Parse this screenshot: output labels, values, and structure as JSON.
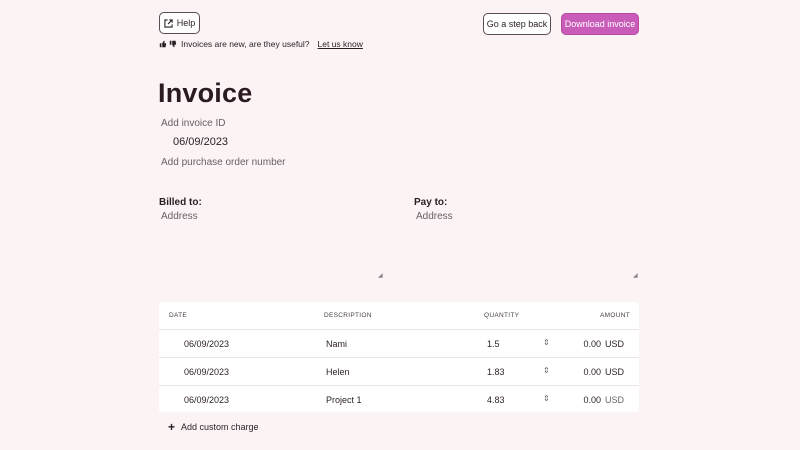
{
  "header": {
    "help_label": "Help",
    "back_label": "Go a step back",
    "download_label": "Download invoice"
  },
  "feedback": {
    "text": "Invoices are new, are they useful?",
    "link": "Let us know"
  },
  "invoice": {
    "title": "Invoice",
    "id_placeholder": "Add invoice ID",
    "date": "06/09/2023",
    "po_placeholder": "Add purchase order number"
  },
  "billed_to": {
    "label": "Billed to:",
    "address_placeholder": "Address"
  },
  "pay_to": {
    "label": "Pay to:",
    "address_placeholder": "Address"
  },
  "table": {
    "headers": {
      "date": "DATE",
      "description": "DESCRIPTION",
      "quantity": "QUANTITY",
      "amount": "AMOUNT"
    },
    "rows": [
      {
        "date": "06/09/2023",
        "description": "Nami",
        "quantity": "1.5",
        "amount": "0.00",
        "currency": "USD"
      },
      {
        "date": "06/09/2023",
        "description": "Helen",
        "quantity": "1.83",
        "amount": "0.00",
        "currency": "USD"
      },
      {
        "date": "06/09/2023",
        "description": "Project 1",
        "quantity": "4.83",
        "amount": "0.00",
        "currency": "USD"
      }
    ]
  },
  "add_charge_label": "Add custom charge",
  "icons": {
    "help": "external-link-icon",
    "thumbs": [
      "thumbs-up-icon",
      "thumbs-down-icon"
    ],
    "stepper": "up-down-chevron-icon",
    "add": "plus-icon"
  },
  "colors": {
    "background": "#fbf3f4",
    "primary": "#c85cb8"
  }
}
